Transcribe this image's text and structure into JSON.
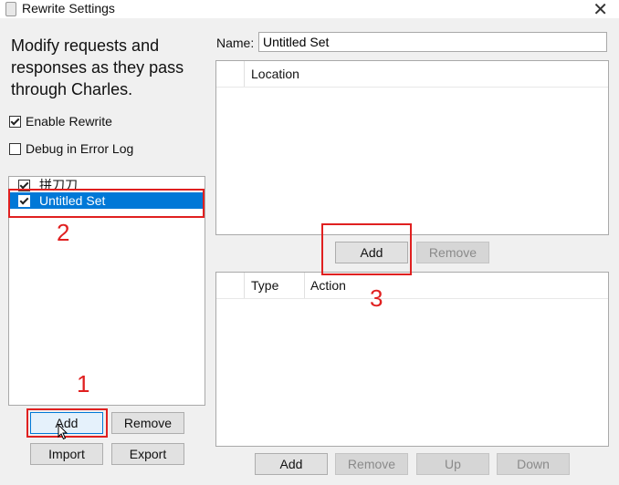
{
  "window": {
    "title": "Rewrite Settings",
    "close_glyph": "✕"
  },
  "left": {
    "description": "Modify requests and responses as they pass through Charles.",
    "enable_rewrite_label": "Enable Rewrite",
    "debug_label": "Debug in Error Log",
    "sets": [
      {
        "label": "拼刀刀",
        "checked": true
      },
      {
        "label": "Untitled Set",
        "checked": true
      }
    ],
    "buttons": {
      "add": "Add",
      "remove": "Remove",
      "import": "Import",
      "export": "Export"
    }
  },
  "right": {
    "name_label": "Name:",
    "name_value": "Untitled Set",
    "location_table": {
      "columns": [
        "Location"
      ]
    },
    "location_buttons": {
      "add": "Add",
      "remove": "Remove"
    },
    "rules_table": {
      "columns": [
        "Type",
        "Action"
      ]
    },
    "rules_buttons": {
      "add": "Add",
      "remove": "Remove",
      "up": "Up",
      "down": "Down"
    }
  },
  "annotations": [
    "1",
    "2",
    "3"
  ],
  "colors": {
    "selection": "#0078d7",
    "annotation": "#e02020"
  }
}
